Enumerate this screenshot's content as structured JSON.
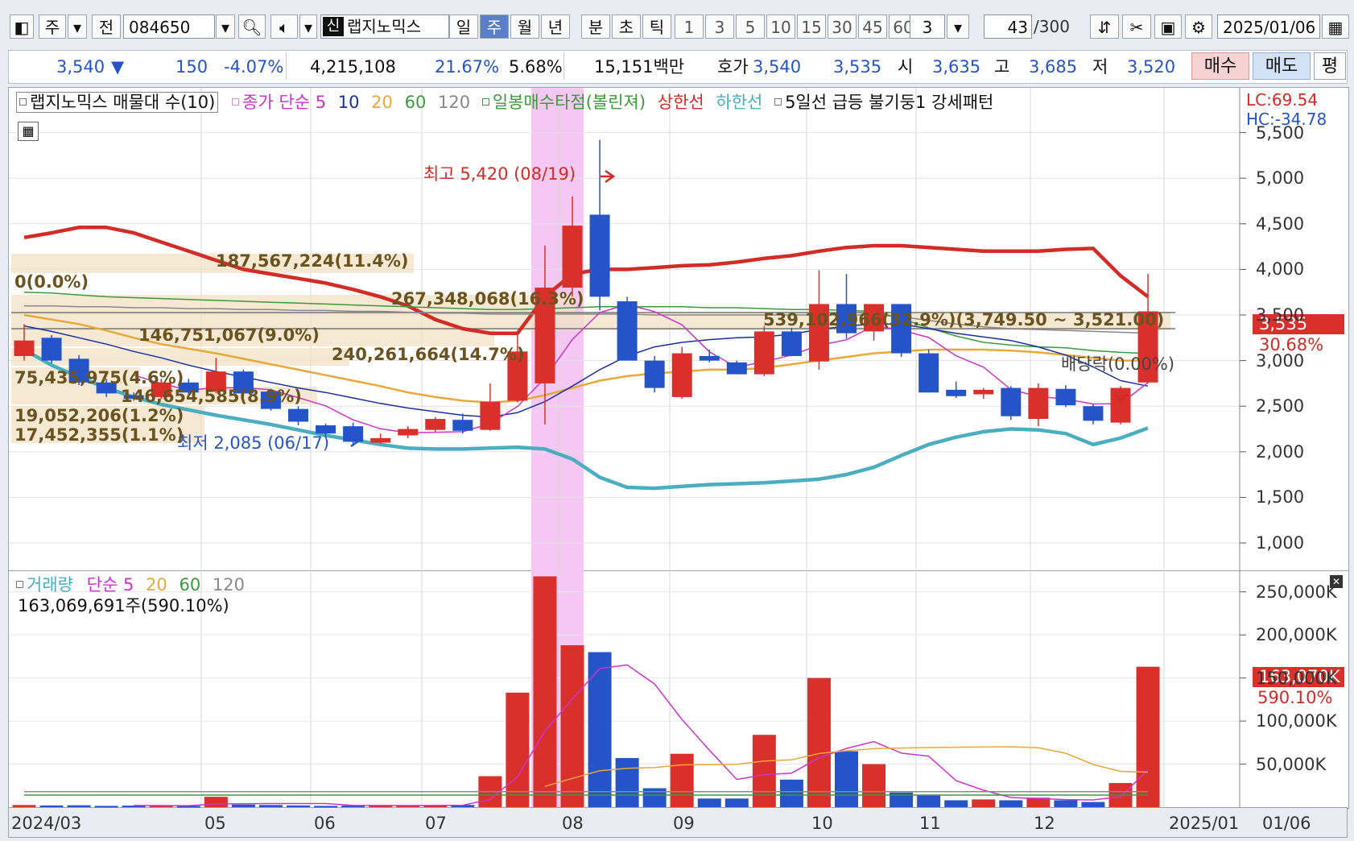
{
  "toolbar": {
    "type_btn": "주",
    "prev_btn": "전",
    "stock_code": "084650",
    "stock_name": "랩지노믹스",
    "new_tag": "신",
    "periods": [
      "일",
      "주",
      "월",
      "년",
      "분",
      "초",
      "틱"
    ],
    "selected_period": "주",
    "intervals": [
      "1",
      "3",
      "5",
      "10",
      "15",
      "30",
      "45",
      "60"
    ],
    "interval_value": "3",
    "count": "43",
    "count_total": "/300",
    "date": "2025/01/06"
  },
  "quote": {
    "price": "3,540",
    "change_arrow": "▼",
    "change": "150",
    "change_pct": "-4.07%",
    "volume": "4,215,108",
    "v1": "21.67%",
    "v2": "5.68%",
    "amount": "15,151백만",
    "bid_label": "호가",
    "bid1": "3,540",
    "bid2": "3,535",
    "open_label": "시",
    "open": "3,635",
    "high_label": "고",
    "high": "3,685",
    "low_label": "저",
    "low": "3,520",
    "buy": "매수",
    "sell": "매도",
    "eval": "평"
  },
  "price_legend": {
    "profile": "랩지노믹스 매물대 수(10)",
    "ma_label": "종가 단순",
    "ma_periods": [
      "5",
      "10",
      "20",
      "60",
      "120"
    ],
    "bollinger": "일봉매수타점(볼린져)",
    "upper": "상한선",
    "lower": "하한선",
    "pattern": "5일선 급등 불기둥1 강세패턴",
    "lc": "LC:69.54",
    "hc": "HC:-34.78"
  },
  "annotations": {
    "high_label": "최고 5,420 (08/19)",
    "low_label": "최저 2,085 (06/17)",
    "dividend": "배당락(0.00%)",
    "current_price": "3,535",
    "current_pct": "30.68%"
  },
  "volume_profile": [
    {
      "label": "187,567,224(11.4%)"
    },
    {
      "label": "0(0.0%)"
    },
    {
      "label": "267,348,068(16.3%)"
    },
    {
      "label": "539,102,966(32.9%)(3,749.50 ~ 3,521.00)"
    },
    {
      "label": "146,751,067(9.0%)"
    },
    {
      "label": "240,261,664(14.7%)"
    },
    {
      "label": "75,435,975(4.6%)"
    },
    {
      "label": "146,654,585(8.9%)"
    },
    {
      "label": "19,052,206(1.2%)"
    },
    {
      "label": "17,452,355(1.1%)"
    }
  ],
  "volume_legend": {
    "title": "거래량",
    "ma_label": "단순",
    "ma_periods": [
      "5",
      "20",
      "60",
      "120"
    ],
    "current": "163,069,691주(590.10%)",
    "cur_vol": "163,070K",
    "cur_pct": "590.10%"
  },
  "colors": {
    "up": "#d9302b",
    "down": "#2454c7",
    "upper": "#d32b26",
    "lower": "#4aaec0",
    "ma5": "#cc33cc",
    "ma10": "#1a2fa0",
    "ma20": "#e8a83a",
    "ma60": "#3b9a3b",
    "ma120": "#888888",
    "highlight": "#f4c8f2"
  },
  "chart_data": {
    "type": "candlestick",
    "interval": "weekly",
    "y_ticks": [
      "5,500",
      "5,000",
      "4,500",
      "4,000",
      "3,500",
      "3,000",
      "2,500",
      "2,000",
      "1,500",
      "1,000"
    ],
    "ylim": [
      700,
      6000
    ],
    "vol_ticks": [
      "250,000K",
      "200,000K",
      "150,000K",
      "100,000K",
      "50,000K"
    ],
    "vol_ylim": [
      0,
      275000
    ],
    "x_labels": [
      "2024/03",
      "05",
      "06",
      "07",
      "08",
      "09",
      "10",
      "11",
      "12",
      "2025/01",
      "01/06"
    ],
    "candles": [
      {
        "o": 3050,
        "h": 3400,
        "l": 3000,
        "c": 3220,
        "v": 2500
      },
      {
        "o": 3250,
        "h": 3280,
        "l": 2970,
        "c": 3000,
        "v": 2000
      },
      {
        "o": 3020,
        "h": 3060,
        "l": 2730,
        "c": 2760,
        "v": 2200
      },
      {
        "o": 2760,
        "h": 2800,
        "l": 2600,
        "c": 2640,
        "v": 1500
      },
      {
        "o": 2620,
        "h": 2650,
        "l": 2560,
        "c": 2580,
        "v": 1800
      },
      {
        "o": 2600,
        "h": 2800,
        "l": 2580,
        "c": 2760,
        "v": 2000
      },
      {
        "o": 2760,
        "h": 2800,
        "l": 2600,
        "c": 2650,
        "v": 1500
      },
      {
        "o": 2660,
        "h": 3030,
        "l": 2640,
        "c": 2880,
        "v": 12000
      },
      {
        "o": 2880,
        "h": 2900,
        "l": 2610,
        "c": 2640,
        "v": 3000
      },
      {
        "o": 2660,
        "h": 2690,
        "l": 2450,
        "c": 2470,
        "v": 2500
      },
      {
        "o": 2470,
        "h": 2500,
        "l": 2290,
        "c": 2330,
        "v": 2000
      },
      {
        "o": 2290,
        "h": 2310,
        "l": 2170,
        "c": 2200,
        "v": 1500
      },
      {
        "o": 2280,
        "h": 2320,
        "l": 2085,
        "c": 2110,
        "v": 1800
      },
      {
        "o": 2100,
        "h": 2200,
        "l": 2090,
        "c": 2150,
        "v": 2000
      },
      {
        "o": 2180,
        "h": 2280,
        "l": 2150,
        "c": 2250,
        "v": 2200
      },
      {
        "o": 2240,
        "h": 2380,
        "l": 2220,
        "c": 2360,
        "v": 2400
      },
      {
        "o": 2350,
        "h": 2420,
        "l": 2200,
        "c": 2230,
        "v": 2600
      },
      {
        "o": 2240,
        "h": 2750,
        "l": 2230,
        "c": 2550,
        "v": 36000
      },
      {
        "o": 2560,
        "h": 3300,
        "l": 2540,
        "c": 3100,
        "v": 133000
      },
      {
        "o": 2750,
        "h": 4260,
        "l": 2300,
        "c": 3800,
        "v": 268000
      },
      {
        "o": 3800,
        "h": 4800,
        "l": 3700,
        "c": 4480,
        "v": 188000
      },
      {
        "o": 4600,
        "h": 5420,
        "l": 3550,
        "c": 3700,
        "v": 180000
      },
      {
        "o": 3650,
        "h": 3700,
        "l": 3000,
        "c": 3000,
        "v": 57000
      },
      {
        "o": 3000,
        "h": 3050,
        "l": 2650,
        "c": 2700,
        "v": 22000
      },
      {
        "o": 2600,
        "h": 3150,
        "l": 2580,
        "c": 3080,
        "v": 62000
      },
      {
        "o": 3050,
        "h": 3120,
        "l": 2980,
        "c": 3000,
        "v": 10000
      },
      {
        "o": 2980,
        "h": 3000,
        "l": 2850,
        "c": 2850,
        "v": 10000
      },
      {
        "o": 2850,
        "h": 3380,
        "l": 2830,
        "c": 3320,
        "v": 84000
      },
      {
        "o": 3320,
        "h": 3360,
        "l": 3050,
        "c": 3050,
        "v": 32000
      },
      {
        "o": 2990,
        "h": 3990,
        "l": 2900,
        "c": 3620,
        "v": 150000
      },
      {
        "o": 3620,
        "h": 3950,
        "l": 3240,
        "c": 3300,
        "v": 65000
      },
      {
        "o": 3320,
        "h": 3620,
        "l": 3220,
        "c": 3620,
        "v": 50000
      },
      {
        "o": 3620,
        "h": 3620,
        "l": 3040,
        "c": 3080,
        "v": 17000
      },
      {
        "o": 3080,
        "h": 3120,
        "l": 2650,
        "c": 2650,
        "v": 14000
      },
      {
        "o": 2680,
        "h": 2770,
        "l": 2590,
        "c": 2610,
        "v": 8000
      },
      {
        "o": 2630,
        "h": 2700,
        "l": 2580,
        "c": 2680,
        "v": 9000
      },
      {
        "o": 2700,
        "h": 2720,
        "l": 2350,
        "c": 2390,
        "v": 8000
      },
      {
        "o": 2360,
        "h": 2750,
        "l": 2280,
        "c": 2700,
        "v": 11000
      },
      {
        "o": 2690,
        "h": 2730,
        "l": 2490,
        "c": 2510,
        "v": 8000
      },
      {
        "o": 2500,
        "h": 2520,
        "l": 2300,
        "c": 2340,
        "v": 6000
      },
      {
        "o": 2320,
        "h": 2720,
        "l": 2300,
        "c": 2700,
        "v": 28000
      },
      {
        "o": 2760,
        "h": 3950,
        "l": 2750,
        "c": 3540,
        "v": 163070
      }
    ]
  }
}
